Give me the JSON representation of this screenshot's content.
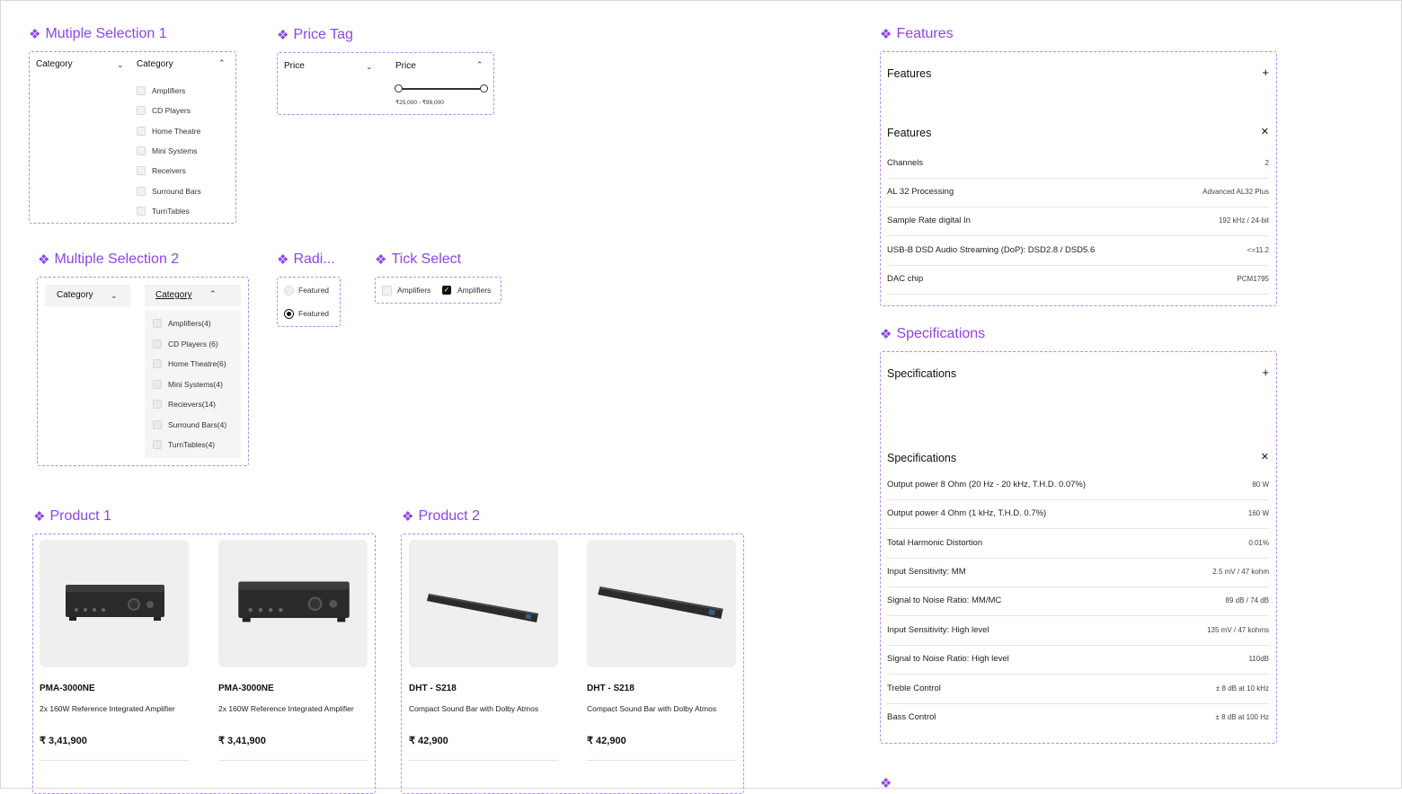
{
  "accent_color": "#8e44e8",
  "icon": "component-diamond-icon",
  "ms1": {
    "title": "Mutiple Selection 1",
    "closed_label": "Category",
    "open_label": "Category",
    "options": [
      "Amplifiers",
      "CD Players",
      "Home Theatre",
      "Mini Systems",
      "Receivers",
      "Surround Bars",
      "TurnTables"
    ]
  },
  "price": {
    "title": "Price Tag",
    "closed_label": "Price",
    "open_label": "Price",
    "range": "₹25,000 - ₹99,000"
  },
  "ms2": {
    "title": "Multiple Selection 2",
    "closed_label": "Category",
    "open_label": "Category",
    "options": [
      "Amplifiers(4)",
      "CD Players (6)",
      "Home Theatre(6)",
      "Mini Systems(4)",
      "Recievers(14)",
      "Surround Bars(4)",
      "TurnTables(4)"
    ]
  },
  "radio": {
    "title": "Radi...",
    "options": [
      "Featured",
      "Featured"
    ]
  },
  "tick": {
    "title": "Tick Select",
    "options": [
      "Amplifiers",
      "Amplifiers"
    ]
  },
  "product1": {
    "title": "Product 1",
    "cards": [
      {
        "name": "PMA-3000NE",
        "desc": "2x 160W Reference Integrated Amplifier",
        "price": "₹ 3,41,900"
      },
      {
        "name": "PMA-3000NE",
        "desc": "2x 160W Reference Integrated Amplifier",
        "price": "₹ 3,41,900"
      }
    ]
  },
  "product2": {
    "title": "Product 2",
    "cards": [
      {
        "name": "DHT - S218",
        "desc": "Compact Sound Bar with Dolby Atmos",
        "price": "₹ 42,900"
      },
      {
        "name": "DHT - S218",
        "desc": "Compact Sound Bar with Dolby Atmos",
        "price": "₹ 42,900"
      }
    ]
  },
  "features": {
    "title": "Features",
    "collapsed_header": "Features",
    "expanded_header": "Features",
    "rows": [
      {
        "k": "Channels",
        "v": "2"
      },
      {
        "k": "AL 32 Processing",
        "v": "Advanced AL32 Plus"
      },
      {
        "k": "Sample Rate digital In",
        "v": "192 kHz / 24-bit"
      },
      {
        "k": "USB-B DSD Audio Streaming (DoP): DSD2.8 / DSD5.6",
        "v": "<=11.2"
      },
      {
        "k": "DAC chip",
        "v": "PCM1795"
      }
    ]
  },
  "specs": {
    "title": "Specifications",
    "collapsed_header": "Specifications",
    "expanded_header": "Specifications",
    "rows": [
      {
        "k": "Output power 8 Ohm (20 Hz - 20 kHz, T.H.D. 0.07%)",
        "v": "80 W"
      },
      {
        "k": "Output power 4 Ohm (1 kHz, T.H.D. 0.7%)",
        "v": "160 W"
      },
      {
        "k": "Total Harmonic Distortion",
        "v": "0.01%"
      },
      {
        "k": "Input Sensitivity: MM",
        "v": "2.5 mV / 47 kohm"
      },
      {
        "k": "Signal to Noise Ratio: MM/MC",
        "v": "89 dB / 74 dB"
      },
      {
        "k": "Input Sensitivity: High level",
        "v": "135 mV / 47 kohms"
      },
      {
        "k": "Signal to Noise Ratio: High level",
        "v": "110dB"
      },
      {
        "k": "Treble Control",
        "v": "± 8 dB at 10 kHz"
      },
      {
        "k": "Bass Control",
        "v": "± 8 dB at 100 Hz"
      }
    ]
  }
}
